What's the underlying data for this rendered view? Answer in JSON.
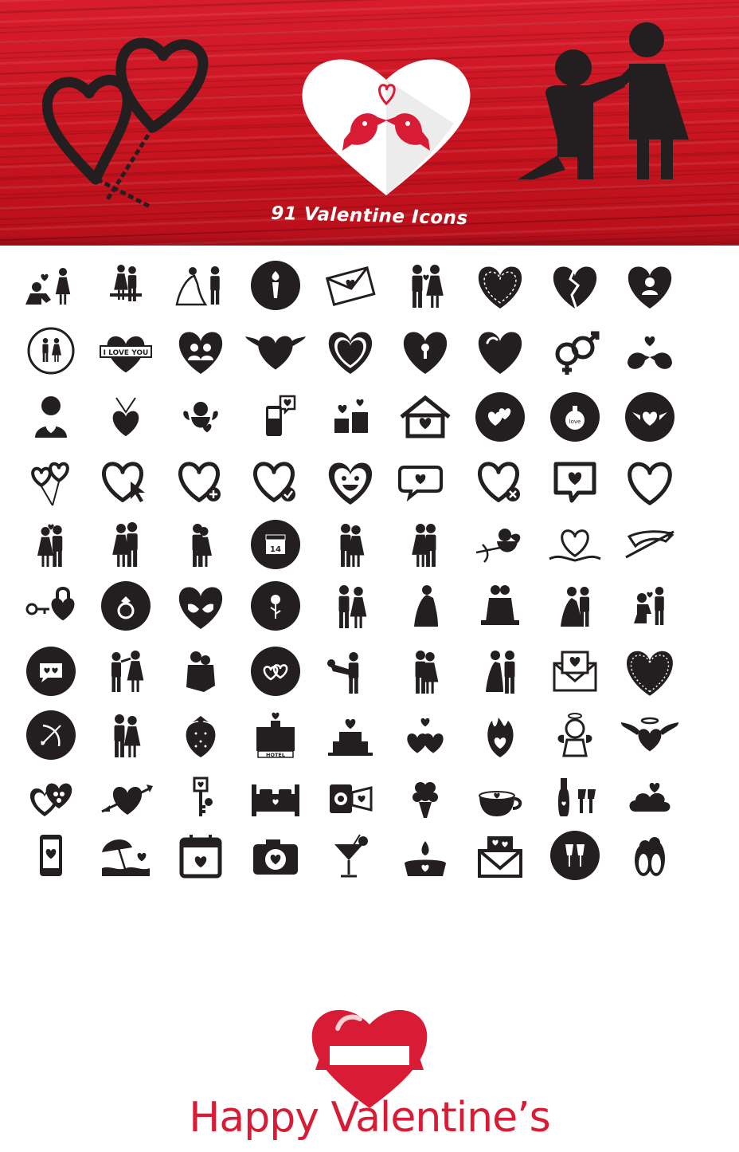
{
  "banner": {
    "title": "91 Valentine Icons",
    "background_color": "#c8141f",
    "art": [
      "heart-lollipops-icon",
      "paper-heart-lovebirds-icon",
      "marriage-proposal-icon"
    ]
  },
  "icons": {
    "rows": [
      [
        "proposal-couple-icon",
        "wedding-couple-bench-icon",
        "bride-groom-running-icon",
        "torch-circle-icon",
        "love-letter-icon",
        "couple-holding-hands-icon",
        "stitched-heart-icon",
        "broken-heart-icon",
        "heart-profile-icon"
      ],
      [
        "couple-circle-icon",
        "i-love-you-heart-banner-icon",
        "heart-couple-icon",
        "winged-heart-icon",
        "heart-outline-icon",
        "heart-keyhole-icon",
        "glossy-heart-icon",
        "gender-symbols-icon",
        "lovebirds-icon"
      ],
      [
        "person-holding-heart-icon",
        "heart-pendant-icon",
        "cupid-icon",
        "phone-heart-icon",
        "gifts-hearts-icon",
        "heart-home-icon",
        "hearts-circle-icon",
        "love-potion-circle-icon",
        "winged-heart-circle-icon"
      ],
      [
        "heart-balloons-icon",
        "heart-click-icon",
        "heart-add-icon",
        "heart-check-icon",
        "smiley-heart-icon",
        "heart-chat-bubbles-icon",
        "heart-remove-icon",
        "heart-message-icon",
        "heart-plain-outline-icon"
      ],
      [
        "couple-kissing-icon",
        "couple-walking-icon",
        "couple-embracing-icon",
        "calendar-14-circle-icon",
        "couple-strolling-icon",
        "couple-side-by-side-icon",
        "cupid-archer-icon",
        "ribbon-heart-icon",
        "cupid-arrow-ribbon-icon"
      ],
      [
        "heart-padlock-key-icon",
        "ring-circle-icon",
        "hands-heart-icon",
        "rose-circle-icon",
        "couple-hand-in-hand-icon",
        "wedding-hug-icon",
        "couple-kneeling-kiss-icon",
        "wedding-dance-icon",
        "man-proposing-icon"
      ],
      [
        "chat-hearts-circle-icon",
        "couple-dancing-icon",
        "couple-sitting-icon",
        "heart-links-circle-icon",
        "groom-carrying-bride-icon",
        "couple-hugging-icon",
        "bride-groom-icon",
        "heart-envelope-icon",
        "lace-heart-icon"
      ],
      [
        "bow-arrow-circle-icon",
        "couple-flowers-icon",
        "strawberry-icon",
        "hotel-icon",
        "wedding-cake-icon",
        "hearts-trio-icon",
        "burning-heart-icon",
        "angel-icon",
        "angel-winged-heart-icon"
      ],
      [
        "chocolate-box-icon",
        "heart-pierced-arrow-icon",
        "heart-keys-icon",
        "double-bed-icon",
        "video-camera-heart-icon",
        "bouquet-icon",
        "coffee-heart-icon",
        "champagne-glasses-icon",
        "heart-cloud-icon"
      ],
      [
        "smartphone-heart-icon",
        "beach-umbrella-icon",
        "calendar-heart-icon",
        "camera-heart-icon",
        "cocktail-icon",
        "candle-icon",
        "envelope-hearts-icon",
        "champagne-toast-circle-icon",
        "penguins-icon"
      ]
    ]
  },
  "footer": {
    "text": "Happy Valentine’s",
    "accent_color": "#d91c35",
    "art": "heart-ribbon-badge-icon"
  }
}
